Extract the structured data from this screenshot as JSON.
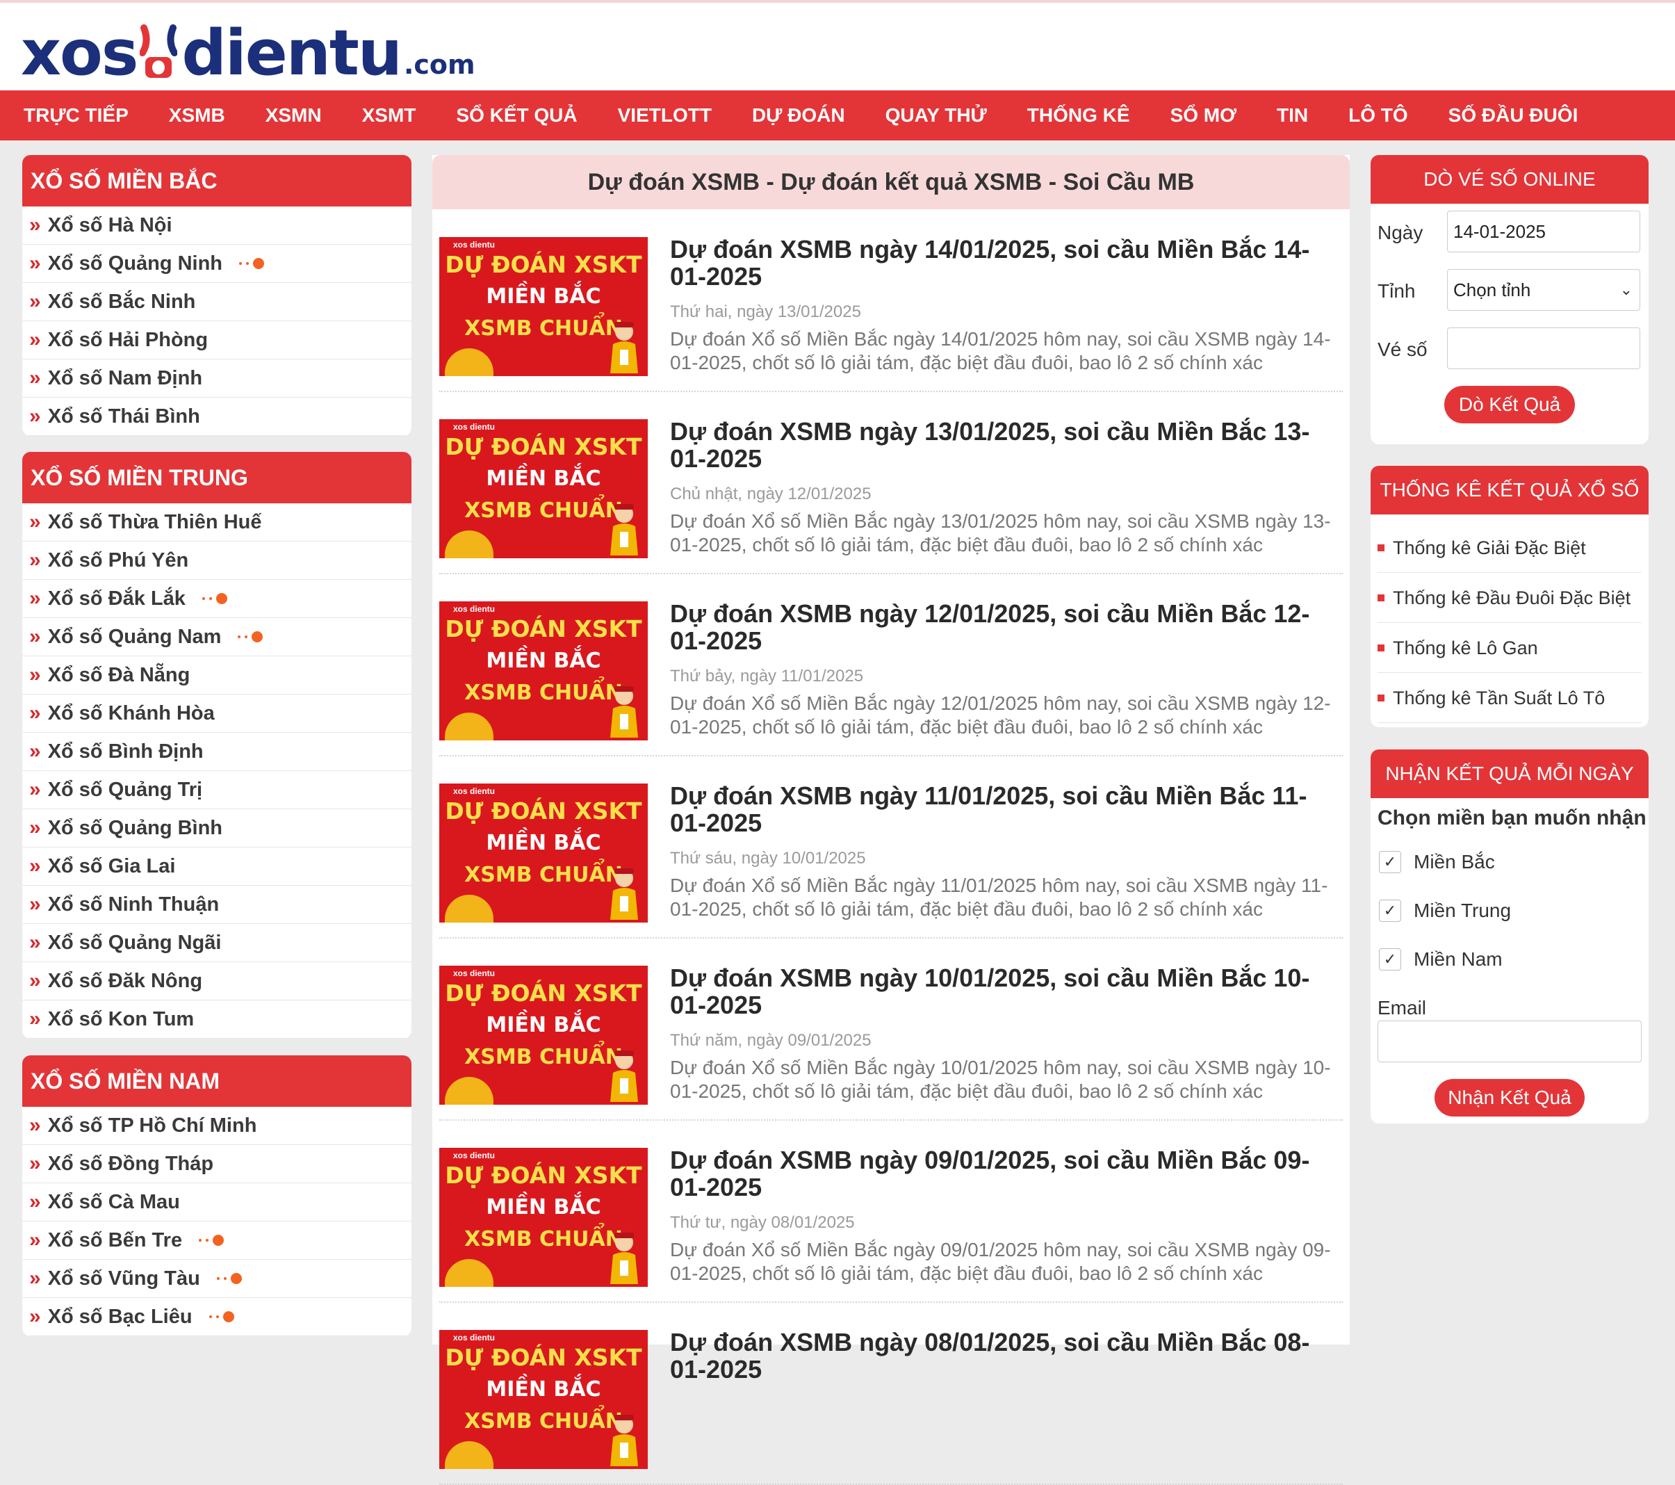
{
  "logo": {
    "part1": "xos",
    "part2": "dientu",
    "tld": ".com"
  },
  "nav": [
    "TRỰC TIẾP",
    "XSMB",
    "XSMN",
    "XSMT",
    "SỔ KẾT QUẢ",
    "VIETLOTT",
    "DỰ ĐOÁN",
    "QUAY THỬ",
    "THỐNG KÊ",
    "SỔ MƠ",
    "TIN",
    "LÔ TÔ",
    "SỐ ĐẦU ĐUÔI"
  ],
  "left": {
    "mien_bac": {
      "title": "XỔ SỐ MIỀN BẮC",
      "items": [
        {
          "label": "Xổ số Hà Nội",
          "live": false
        },
        {
          "label": "Xổ số Quảng Ninh",
          "live": true
        },
        {
          "label": "Xổ số Bắc Ninh",
          "live": false
        },
        {
          "label": "Xổ số Hải Phòng",
          "live": false
        },
        {
          "label": "Xổ số Nam Định",
          "live": false
        },
        {
          "label": "Xổ số Thái Bình",
          "live": false
        }
      ]
    },
    "mien_trung": {
      "title": "XỔ SỐ MIỀN TRUNG",
      "items": [
        {
          "label": "Xổ số Thừa Thiên Huế",
          "live": false
        },
        {
          "label": "Xổ số Phú Yên",
          "live": false
        },
        {
          "label": "Xổ số Đắk Lắk",
          "live": true
        },
        {
          "label": "Xổ số Quảng Nam",
          "live": true
        },
        {
          "label": "Xổ số Đà Nẵng",
          "live": false
        },
        {
          "label": "Xổ số Khánh Hòa",
          "live": false
        },
        {
          "label": "Xổ số Bình Định",
          "live": false
        },
        {
          "label": "Xổ số Quảng Trị",
          "live": false
        },
        {
          "label": "Xổ số Quảng Bình",
          "live": false
        },
        {
          "label": "Xổ số Gia Lai",
          "live": false
        },
        {
          "label": "Xổ số Ninh Thuận",
          "live": false
        },
        {
          "label": "Xổ số Quảng Ngãi",
          "live": false
        },
        {
          "label": "Xổ số Đăk Nông",
          "live": false
        },
        {
          "label": "Xổ số Kon Tum",
          "live": false
        }
      ]
    },
    "mien_nam": {
      "title": "XỔ SỐ MIỀN NAM",
      "items": [
        {
          "label": "Xổ số TP Hồ Chí Minh",
          "live": false
        },
        {
          "label": "Xổ số Đồng Tháp",
          "live": false
        },
        {
          "label": "Xổ số Cà Mau",
          "live": false
        },
        {
          "label": "Xổ số Bến Tre",
          "live": true
        },
        {
          "label": "Xổ số Vũng Tàu",
          "live": true
        },
        {
          "label": "Xổ số Bạc Liêu",
          "live": true
        }
      ]
    }
  },
  "center": {
    "title": "Dự đoán XSMB - Dự đoán kết quả XSMB - Soi Cầu MB",
    "thumb": {
      "brand": "xos dientu",
      "line1": "DỰ ĐOÁN XSKT",
      "line2": "MIỀN BẮC",
      "line3": "XSMB CHUẨN"
    },
    "posts": [
      {
        "title": "Dự đoán XSMB ngày 14/01/2025, soi cầu Miền Bắc 14-01-2025",
        "date": "Thứ hai, ngày 13/01/2025",
        "desc": "Dự đoán Xổ số Miền Bắc ngày 14/01/2025 hôm nay, soi cầu XSMB ngày 14-01-2025, chốt số lô giải tám, đặc biệt đầu đuôi, bao lô 2 số chính xác"
      },
      {
        "title": "Dự đoán XSMB ngày 13/01/2025, soi cầu Miền Bắc 13-01-2025",
        "date": "Chủ nhật, ngày 12/01/2025",
        "desc": "Dự đoán Xổ số Miền Bắc ngày 13/01/2025 hôm nay, soi cầu XSMB ngày 13-01-2025, chốt số lô giải tám, đặc biệt đầu đuôi, bao lô 2 số chính xác"
      },
      {
        "title": "Dự đoán XSMB ngày 12/01/2025, soi cầu Miền Bắc 12-01-2025",
        "date": "Thứ bảy, ngày 11/01/2025",
        "desc": "Dự đoán Xổ số Miền Bắc ngày 12/01/2025 hôm nay, soi cầu XSMB ngày 12-01-2025, chốt số lô giải tám, đặc biệt đầu đuôi, bao lô 2 số chính xác"
      },
      {
        "title": "Dự đoán XSMB ngày 11/01/2025, soi cầu Miền Bắc 11-01-2025",
        "date": "Thứ sáu, ngày 10/01/2025",
        "desc": "Dự đoán Xổ số Miền Bắc ngày 11/01/2025 hôm nay, soi cầu XSMB ngày 11-01-2025, chốt số lô giải tám, đặc biệt đầu đuôi, bao lô 2 số chính xác"
      },
      {
        "title": "Dự đoán XSMB ngày 10/01/2025, soi cầu Miền Bắc 10-01-2025",
        "date": "Thứ năm, ngày 09/01/2025",
        "desc": "Dự đoán Xổ số Miền Bắc ngày 10/01/2025 hôm nay, soi cầu XSMB ngày 10-01-2025, chốt số lô giải tám, đặc biệt đầu đuôi, bao lô 2 số chính xác"
      },
      {
        "title": "Dự đoán XSMB ngày 09/01/2025, soi cầu Miền Bắc 09-01-2025",
        "date": "Thứ tư, ngày 08/01/2025",
        "desc": "Dự đoán Xổ số Miền Bắc ngày 09/01/2025 hôm nay, soi cầu XSMB ngày 09-01-2025, chốt số lô giải tám, đặc biệt đầu đuôi, bao lô 2 số chính xác"
      },
      {
        "title": "Dự đoán XSMB ngày 08/01/2025, soi cầu Miền Bắc 08-01-2025",
        "date": "",
        "desc": ""
      }
    ]
  },
  "right": {
    "do_ve": {
      "title": "DÒ VÉ SỐ ONLINE",
      "date_label": "Ngày",
      "date_value": "14-01-2025",
      "province_label": "Tỉnh",
      "province_value": "Chọn tỉnh",
      "ticket_label": "Vé số",
      "ticket_value": "",
      "button": "Dò Kết Quả"
    },
    "thong_ke": {
      "title": "THỐNG KÊ KẾT QUẢ XỔ SỐ",
      "items": [
        "Thống kê Giải Đặc Biệt",
        "Thống kê Đầu Đuôi Đặc Biệt",
        "Thống kê Lô Gan",
        "Thống kê Tần Suất Lô Tô"
      ]
    },
    "nhan_kq": {
      "title": "NHẬN KẾT QUẢ MỖI NGÀY",
      "prompt": "Chọn miền bạn muốn nhận",
      "options": [
        {
          "label": "Miền Bắc",
          "checked": true
        },
        {
          "label": "Miền Trung",
          "checked": true
        },
        {
          "label": "Miền Nam",
          "checked": true
        }
      ],
      "email_label": "Email",
      "email_value": "",
      "button": "Nhận Kết Quả"
    }
  },
  "colors": {
    "brand_red": "#e33538",
    "logo_blue": "#1c2f7a",
    "live_dot": "#f26322"
  }
}
